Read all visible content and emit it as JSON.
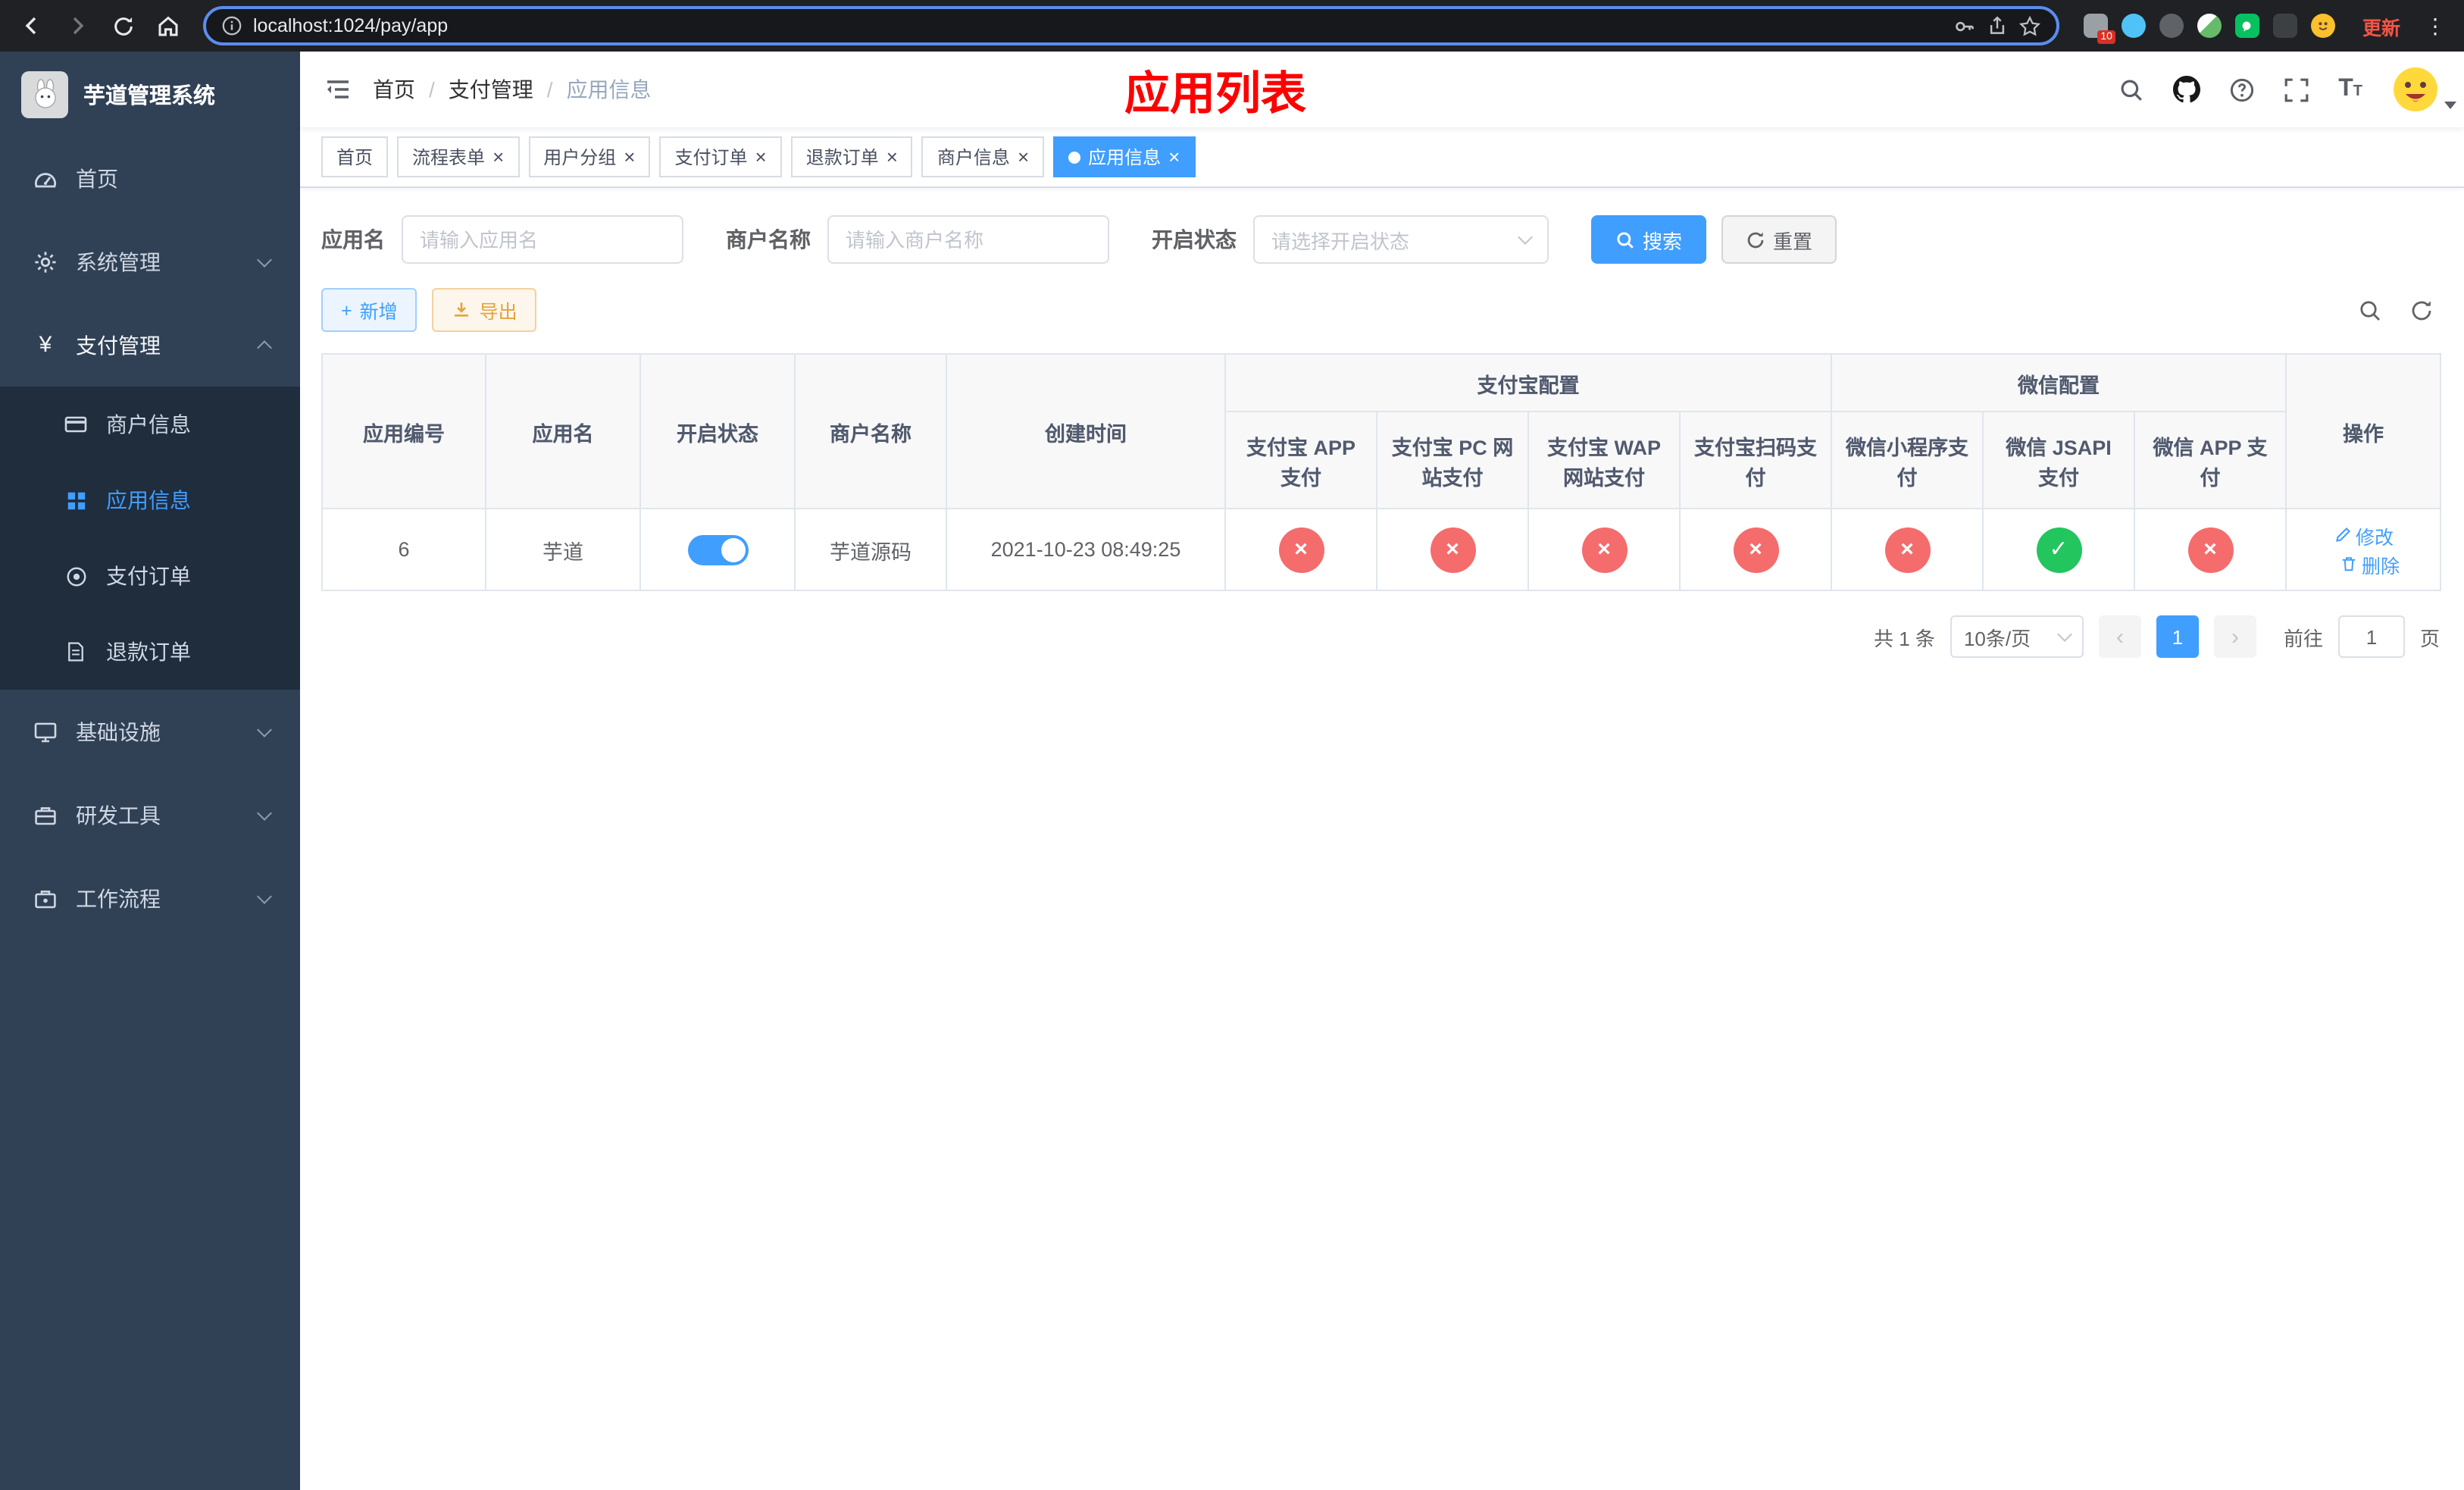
{
  "colors": {
    "primary": "#409eff",
    "danger": "#f56c6c",
    "success": "#22c55e",
    "title_red": "#ff0000"
  },
  "icons": {
    "close": "×",
    "plus": "+",
    "prev": "‹",
    "next": "›",
    "kebab": "⋮",
    "yen": "¥"
  },
  "browser": {
    "url": "localhost:1024/pay/app",
    "update_label": "更新",
    "extension_badge": "10"
  },
  "sidebar": {
    "logo_title": "芋道管理系统",
    "items": [
      {
        "label": "首页"
      },
      {
        "label": "系统管理"
      },
      {
        "label": "支付管理",
        "children": [
          {
            "label": "商户信息"
          },
          {
            "label": "应用信息",
            "active": true
          },
          {
            "label": "支付订单"
          },
          {
            "label": "退款订单"
          }
        ]
      },
      {
        "label": "基础设施"
      },
      {
        "label": "研发工具"
      },
      {
        "label": "工作流程"
      }
    ]
  },
  "header": {
    "breadcrumb": [
      "首页",
      "支付管理",
      "应用信息"
    ],
    "page_title": "应用列表"
  },
  "tabs": [
    {
      "label": "首页",
      "closable": false
    },
    {
      "label": "流程表单",
      "closable": true
    },
    {
      "label": "用户分组",
      "closable": true
    },
    {
      "label": "支付订单",
      "closable": true
    },
    {
      "label": "退款订单",
      "closable": true
    },
    {
      "label": "商户信息",
      "closable": true
    },
    {
      "label": "应用信息",
      "closable": true,
      "active": true
    }
  ],
  "filters": {
    "app_name_label": "应用名",
    "app_name_placeholder": "请输入应用名",
    "merchant_name_label": "商户名称",
    "merchant_name_placeholder": "请输入商户名称",
    "status_label": "开启状态",
    "status_placeholder": "请选择开启状态",
    "search_button": "搜索",
    "reset_button": "重置"
  },
  "toolbar": {
    "add_button": "新增",
    "export_button": "导出"
  },
  "table": {
    "headers": {
      "app_id": "应用编号",
      "app_name": "应用名",
      "status": "开启状态",
      "merchant": "商户名称",
      "created": "创建时间",
      "alipay_group": "支付宝配置",
      "wechat_group": "微信配置",
      "alipay_app": "支付宝 APP 支付",
      "alipay_pc": "支付宝 PC 网站支付",
      "alipay_wap": "支付宝 WAP 网站支付",
      "alipay_qr": "支付宝扫码支付",
      "wx_mini": "微信小程序支付",
      "wx_jsapi": "微信 JSAPI 支付",
      "wx_app": "微信 APP 支付",
      "actions": "操作"
    },
    "rows": [
      {
        "app_id": "6",
        "app_name": "芋道",
        "status_on": true,
        "merchant": "芋道源码",
        "created": "2021-10-23 08:49:25",
        "configs": [
          "no",
          "no",
          "no",
          "no",
          "no",
          "yes",
          "no"
        ],
        "edit": "修改",
        "delete": "删除"
      }
    ]
  },
  "pagination": {
    "total": "共 1 条",
    "page_size": "10条/页",
    "page": "1",
    "goto_label": "前往",
    "goto_value": "1",
    "unit": "页"
  }
}
